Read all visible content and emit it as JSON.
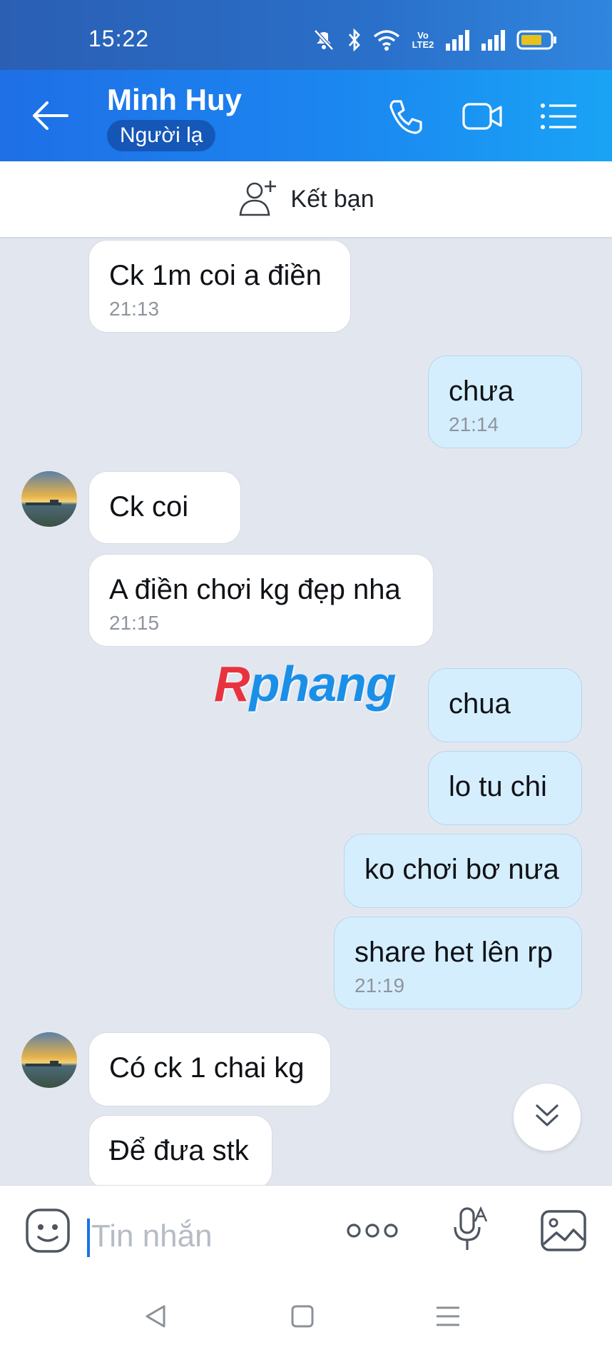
{
  "status_bar": {
    "time": "15:22",
    "volte_label": "Vo LTE2",
    "battery_color": "#e8c11c"
  },
  "header": {
    "contact_name": "Minh Huy",
    "badge": "Người lạ"
  },
  "add_friend": {
    "label": "Kết bạn"
  },
  "messages": [
    {
      "side": "received",
      "text": "Ck 1m coi a điền",
      "time": "21:13"
    },
    {
      "side": "sent",
      "text": "chưa",
      "time": "21:14"
    },
    {
      "side": "received",
      "text": "Ck coi",
      "time": ""
    },
    {
      "side": "received",
      "text": "A điền chơi kg đẹp nha",
      "time": "21:15"
    },
    {
      "side": "sent",
      "text": "chua",
      "time": ""
    },
    {
      "side": "sent",
      "text": "lo tu chi",
      "time": ""
    },
    {
      "side": "sent",
      "text": "ko chơi bơ nưa",
      "time": ""
    },
    {
      "side": "sent",
      "text": "share het lên rp",
      "time": "21:19"
    },
    {
      "side": "received",
      "text": "Có ck 1 chai kg",
      "time": ""
    },
    {
      "side": "received",
      "text": "Để đưa stk",
      "time": ""
    }
  ],
  "watermark": {
    "first": "R",
    "rest": "phang"
  },
  "composer": {
    "placeholder": "Tin nhắn"
  },
  "colors": {
    "header_gradient_start": "#1f6fe6",
    "header_gradient_end": "#1aa3f5",
    "sent_bubble": "#d5eefd",
    "received_bubble": "#ffffff",
    "chat_background": "#e2e7ef",
    "accent": "#1a73e8"
  }
}
